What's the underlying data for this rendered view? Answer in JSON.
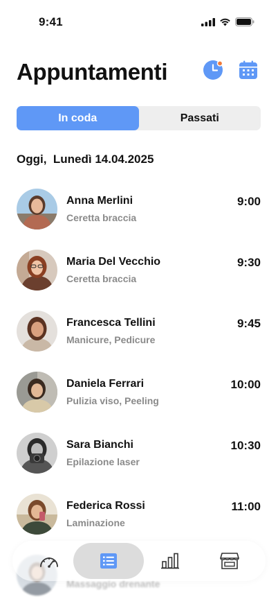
{
  "status_bar": {
    "time": "9:41"
  },
  "header": {
    "title": "Appuntamenti",
    "icons": [
      "clock-icon",
      "calendar-icon"
    ],
    "notification_dot_color": "#f07a3a"
  },
  "tabs": {
    "queued": "In coda",
    "past": "Passati",
    "active": "queued"
  },
  "date_heading": "Oggi,  Lunedì 14.04.2025",
  "appointments": [
    {
      "name": "Anna Merlini",
      "service": "Ceretta braccia",
      "time": "9:00"
    },
    {
      "name": "Maria Del Vecchio",
      "service": "Ceretta braccia",
      "time": "9:30"
    },
    {
      "name": "Francesca Tellini",
      "service": "Manicure, Pedicure",
      "time": "9:45"
    },
    {
      "name": "Daniela Ferrari",
      "service": "Pulizia viso, Peeling",
      "time": "10:00"
    },
    {
      "name": "Sara Bianchi",
      "service": "Epilazione laser",
      "time": "10:30"
    },
    {
      "name": "Federica Rossi",
      "service": "Laminazione",
      "time": "11:00"
    },
    {
      "name": "",
      "service": "Massaggio drenante",
      "time": ""
    }
  ],
  "bottom_nav": {
    "items": [
      "dashboard-gauge-icon",
      "list-icon",
      "bar-chart-icon",
      "store-icon"
    ],
    "active": "list-icon"
  },
  "colors": {
    "accent": "#5f98f6",
    "muted_text": "#8a8a8a",
    "segment_bg": "#eeeeee"
  }
}
